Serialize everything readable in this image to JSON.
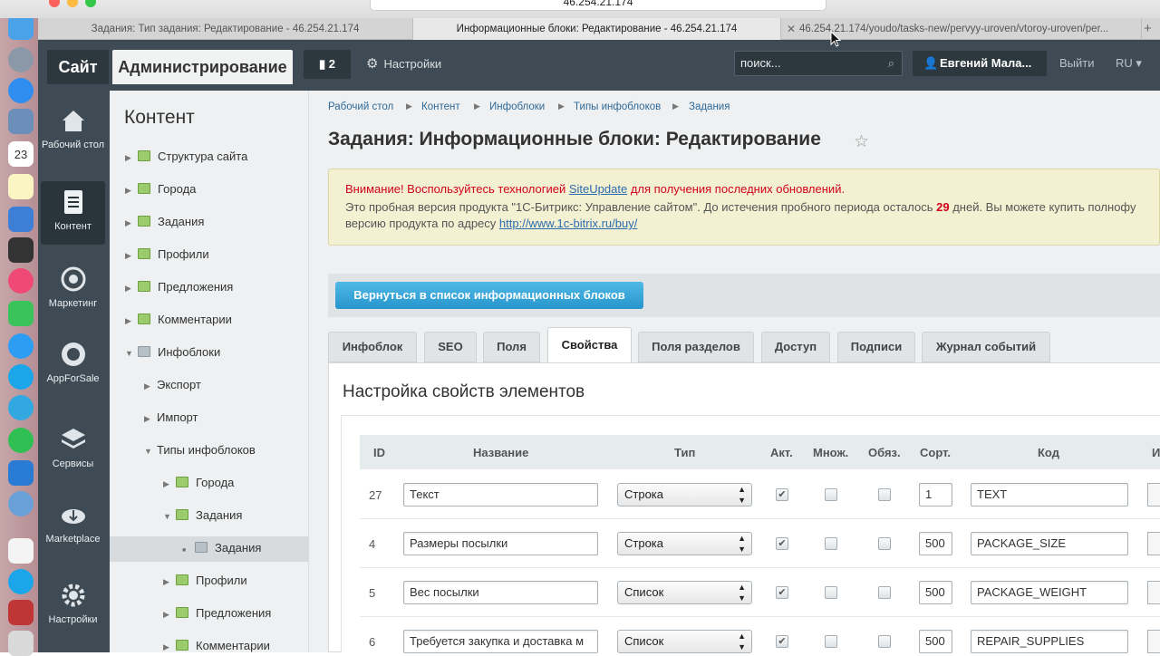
{
  "browser": {
    "url": "46.254.21.174",
    "tabs": [
      {
        "title": "Задания: Тип задания: Редактирование - 46.254.21.174"
      },
      {
        "title": "Информационные блоки: Редактирование - 46.254.21.174"
      },
      {
        "title": "46.254.21.174/youdo/tasks-new/pervyy-uroven/vtoroy-uroven/per..."
      }
    ]
  },
  "header": {
    "site_label": "Сайт",
    "admin_label": "Администрирование",
    "notifications_count": "2",
    "settings_label": "Настройки",
    "search_placeholder": "поиск...",
    "user_name": "Евгений Мала...",
    "logout_label": "Выйти",
    "lang": "RU"
  },
  "leftnav": {
    "items": [
      {
        "label": "Рабочий стол",
        "icon": "home-icon"
      },
      {
        "label": "Контент",
        "icon": "document-icon"
      },
      {
        "label": "Маркетинг",
        "icon": "target-icon"
      },
      {
        "label": "AppForSale",
        "icon": "appforsale-icon"
      },
      {
        "label": "Сервисы",
        "icon": "layers-icon"
      },
      {
        "label": "Marketplace",
        "icon": "cloud-download-icon"
      },
      {
        "label": "Настройки",
        "icon": "gear-icon"
      }
    ]
  },
  "tree": {
    "title": "Контент",
    "items": [
      {
        "label": "Структура сайта"
      },
      {
        "label": "Города"
      },
      {
        "label": "Задания"
      },
      {
        "label": "Профили"
      },
      {
        "label": "Предложения"
      },
      {
        "label": "Комментарии"
      },
      {
        "label": "Инфоблоки"
      },
      {
        "label": "Экспорт"
      },
      {
        "label": "Импорт"
      },
      {
        "label": "Типы инфоблоков"
      },
      {
        "label": "Города"
      },
      {
        "label": "Задания"
      },
      {
        "label": "Задания"
      },
      {
        "label": "Профили"
      },
      {
        "label": "Предложения"
      },
      {
        "label": "Комментарии"
      }
    ]
  },
  "breadcrumbs": [
    "Рабочий стол",
    "Контент",
    "Инфоблоки",
    "Типы инфоблоков",
    "Задания"
  ],
  "page_title": "Задания: Информационные блоки: Редактирование",
  "alert": {
    "line1_before": "Внимание! Воспользуйтесь технологией ",
    "line1_link": "SiteUpdate",
    "line1_after": " для получения последних обновлений.",
    "line2_before": "Это пробная версия продукта \"1С-Битрикс: Управление сайтом\". До истечения пробного периода осталось ",
    "days": "29",
    "line2_after": " дней. Вы можете купить полнофу",
    "line3_before": "версию продукта по адресу ",
    "line3_link": "http://www.1c-bitrix.ru/buy/"
  },
  "back_button": "Вернуться в список информационных блоков",
  "tabs": [
    "Инфоблок",
    "SEO",
    "Поля",
    "Свойства",
    "Поля разделов",
    "Доступ",
    "Подписи",
    "Журнал событий"
  ],
  "panel_title": "Настройка свойств элементов",
  "table": {
    "headers": [
      "ID",
      "Название",
      "Тип",
      "Акт.",
      "Множ.",
      "Обяз.",
      "Сорт.",
      "Код",
      "И"
    ],
    "rows": [
      {
        "id": "27",
        "name": "Текст",
        "type": "Строка",
        "active": true,
        "multiple": false,
        "required": false,
        "sort": "1",
        "code": "TEXT"
      },
      {
        "id": "4",
        "name": "Размеры посылки",
        "type": "Строка",
        "active": true,
        "multiple": false,
        "required": false,
        "sort": "500",
        "code": "PACKAGE_SIZE"
      },
      {
        "id": "5",
        "name": "Вес посылки",
        "type": "Список",
        "active": true,
        "multiple": false,
        "required": false,
        "sort": "500",
        "code": "PACKAGE_WEIGHT"
      },
      {
        "id": "6",
        "name": "Требуется закупка и доставка м",
        "type": "Список",
        "active": true,
        "multiple": false,
        "required": false,
        "sort": "500",
        "code": "REPAIR_SUPPLIES"
      }
    ]
  },
  "colors": {
    "header_bg": "#3f4b54",
    "accent_blue": "#2796cd",
    "alert_red": "#d0021b"
  }
}
